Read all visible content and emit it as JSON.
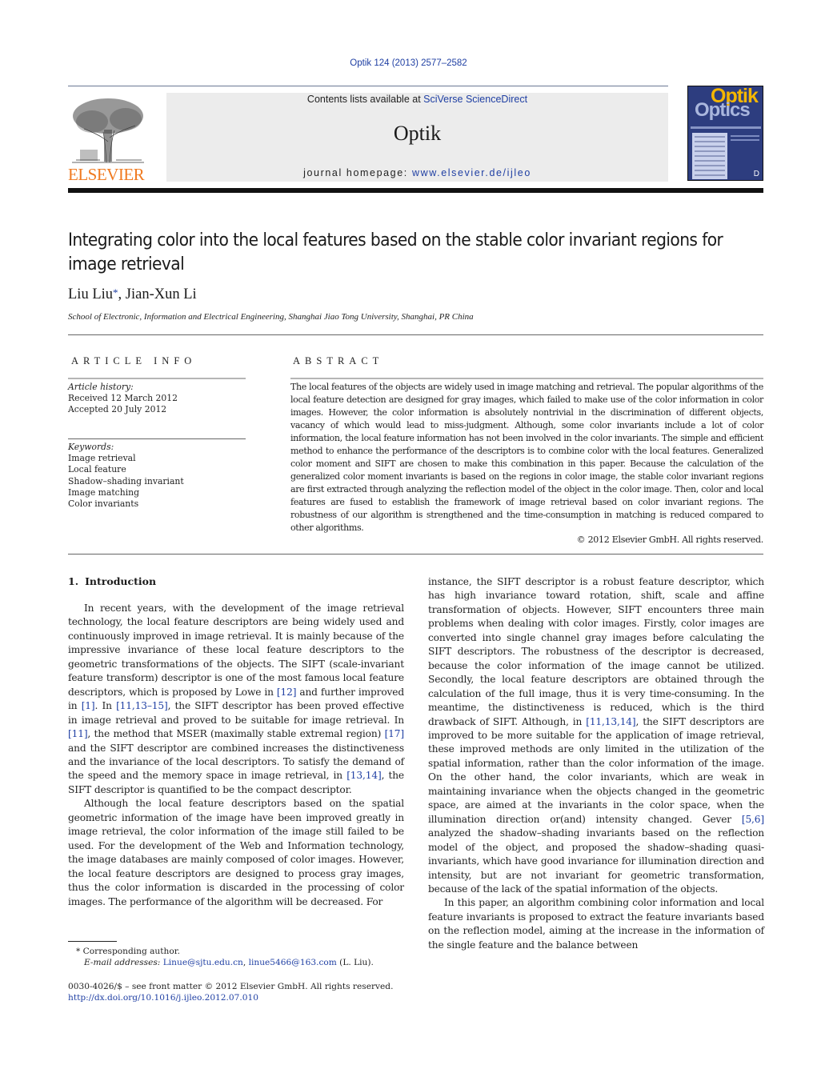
{
  "header": {
    "citation": "Optik 124 (2013) 2577–2582",
    "contents_prefix": "Contents lists available at ",
    "contents_link": "SciVerse ScienceDirect",
    "journal_name": "Optik",
    "homepage_prefix": "journal homepage: ",
    "homepage_link": "www.elsevier.de/ijleo",
    "publisher_logo_text": "ELSEVIER",
    "cover": {
      "title_top": "Optik",
      "title_bottom": "Optics",
      "mark": "D"
    }
  },
  "colors": {
    "link": "#1f3fa3",
    "elsevier_orange": "#f07a20",
    "cover_blue": "#2d3d7f",
    "cover_yellow": "#f4b600"
  },
  "article": {
    "title": "Integrating color into the local features based on the stable color invariant regions for image retrieval",
    "authors": [
      {
        "name": "Liu Liu",
        "marker": "*"
      },
      {
        "name": "Jian-Xun Li",
        "marker": ""
      }
    ],
    "author_separator": ", ",
    "affiliation": "School of Electronic, Information and Electrical Engineering, Shanghai Jiao Tong University, Shanghai, PR China"
  },
  "article_info": {
    "heading": "ARTICLE INFO",
    "history_label": "Article history:",
    "received": "Received 12 March 2012",
    "accepted": "Accepted 20 July 2012",
    "keywords_label": "Keywords:",
    "keywords": [
      "Image retrieval",
      "Local feature",
      "Shadow–shading invariant",
      "Image matching",
      "Color invariants"
    ]
  },
  "abstract": {
    "heading": "ABSTRACT",
    "text": "The local features of the objects are widely used in image matching and retrieval. The popular algorithms of the local feature detection are designed for gray images, which failed to make use of the color information in color images. However, the color information is absolutely nontrivial in the discrimination of different objects, vacancy of which would lead to miss-judgment. Although, some color invariants include a lot of color information, the local feature information has not been involved in the color invariants. The simple and efficient method to enhance the performance of the descriptors is to combine color with the local features. Generalized color moment and SIFT are chosen to make this combination in this paper. Because the calculation of the generalized color moment invariants is based on the regions in color image, the stable color invariant regions are first extracted through analyzing the reflection model of the object in the color image. Then, color and local features are fused to establish the framework of image retrieval based on color invariant regions. The robustness of our algorithm is strengthened and the time-consumption in matching is reduced compared to other algorithms.",
    "copyright": "© 2012 Elsevier GmbH. All rights reserved."
  },
  "body": {
    "section_number": "1.",
    "section_title": "Introduction",
    "paragraphs": [
      {
        "segments": [
          {
            "t": "In recent years, with the development of the image retrieval technology, the local feature descriptors are being widely used and continuously improved in image retrieval. It is mainly because of the impressive invariance of these local feature descriptors to the geometric transformations of the objects. The SIFT (scale-invariant feature transform) descriptor is one of the most famous local feature descriptors, which is proposed by Lowe in "
          },
          {
            "ref": "[12]"
          },
          {
            "t": " and further improved in "
          },
          {
            "ref": "[1]"
          },
          {
            "t": ". In "
          },
          {
            "ref": "[11,13–15]"
          },
          {
            "t": ", the SIFT descriptor has been proved effective in image retrieval and proved to be suitable for image retrieval. In "
          },
          {
            "ref": "[11]"
          },
          {
            "t": ", the method that MSER (maximally stable extremal region) "
          },
          {
            "ref": "[17]"
          },
          {
            "t": " and the SIFT descriptor are combined increases the distinctiveness and the invariance of the local descriptors. To satisfy the demand of the speed and the memory space in image retrieval, in "
          },
          {
            "ref": "[13,14]"
          },
          {
            "t": ", the SIFT descriptor is quantified to be the compact descriptor."
          }
        ]
      },
      {
        "segments": [
          {
            "t": "Although the local feature descriptors based on the spatial geometric information of the image have been improved greatly in image retrieval, the color information of the image still failed to be used. For the development of the Web and Information technology, the image databases are mainly composed of color images. However, the local feature descriptors are designed to process gray images, thus the color information is discarded in the processing of color images. The performance of the algorithm will be decreased. For instance, the SIFT descriptor is a robust feature descriptor, which has high invariance toward rotation, shift, scale and affine transformation of objects. However, SIFT encounters three main problems when dealing with color images. Firstly, color images are converted into single channel gray images before calculating the SIFT descriptors. The robustness of the descriptor is decreased, because the color information of the image cannot be utilized. Secondly, the local feature descriptors are obtained through the calculation of the full image, thus it is very time-consuming. In the meantime, the distinctiveness is reduced, which is the third drawback of SIFT. Although, in "
          },
          {
            "ref": "[11,13,14]"
          },
          {
            "t": ", the SIFT descriptors are improved to be more suitable for the application of image retrieval, these improved methods are only limited in the utilization of the spatial information, rather than the color information of the image. On the other hand, the color invariants, which are weak in maintaining invariance when the objects changed in the geometric space, are aimed at the invariants in the color space, when the illumination direction or(and) intensity changed. Gever "
          },
          {
            "ref": "[5,6]"
          },
          {
            "t": " analyzed the shadow–shading invariants based on the reflection model of the object, and proposed the shadow–shading quasi-invariants, which have good invariance for illumination direction and intensity, but are not invariant for geometric transformation, because of the lack of the spatial information of the objects."
          }
        ]
      },
      {
        "segments": [
          {
            "t": "In this paper, an algorithm combining color information and local feature invariants is proposed to extract the feature invariants based on the reflection model, aiming at the increase in the information of the single feature and the balance between"
          }
        ]
      }
    ]
  },
  "footnote": {
    "marker": "*",
    "corresponding": "Corresponding author.",
    "email_label": "E-mail addresses:",
    "emails": [
      "Linue@sjtu.edu.cn",
      "linue5466@163.com"
    ],
    "email_suffix": " (L. Liu)."
  },
  "front_matter": {
    "issn_line": "0030-4026/$ – see front matter © 2012 Elsevier GmbH. All rights reserved.",
    "doi": "http://dx.doi.org/10.1016/j.ijleo.2012.07.010"
  }
}
